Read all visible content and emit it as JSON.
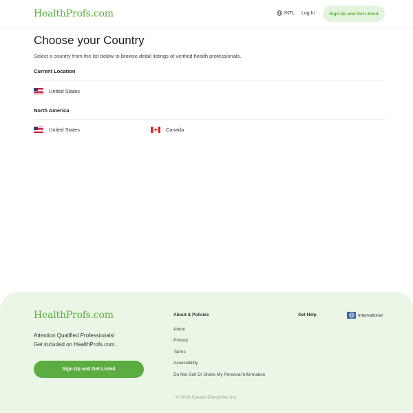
{
  "header": {
    "logo": "HealthProfs.com",
    "intl_label": "INTL",
    "login_label": "Log In",
    "signup_label": "Sign Up and Get Listed"
  },
  "main": {
    "title": "Choose your Country",
    "subtitle": "Select a country from the list below to browse detail listings of verified health professionals.",
    "current_location": {
      "heading": "Current Location",
      "countries": [
        "United States"
      ]
    },
    "north_america": {
      "heading": "North America",
      "countries": [
        "United States",
        "Canada"
      ]
    }
  },
  "footer": {
    "logo": "HealthProfs.com",
    "attention_line1": "Attention Qualified Professionals!",
    "attention_line2": "Get included on HealthProfs.com.",
    "signup_label": "Sign Up and Get Listed",
    "policies": {
      "heading": "About & Policies",
      "links": [
        "About",
        "Privacy",
        "Terms",
        "Accessibility",
        "Do Not Sell Or Share My Personal Information"
      ]
    },
    "help_heading": "Get Help",
    "international_label": "International",
    "copyright": "© 2026 Sussex Directories Inc."
  },
  "colors": {
    "brand_green": "#5aad3e",
    "light_green": "#e4f4de",
    "footer_bg": "#eaf6e6"
  }
}
